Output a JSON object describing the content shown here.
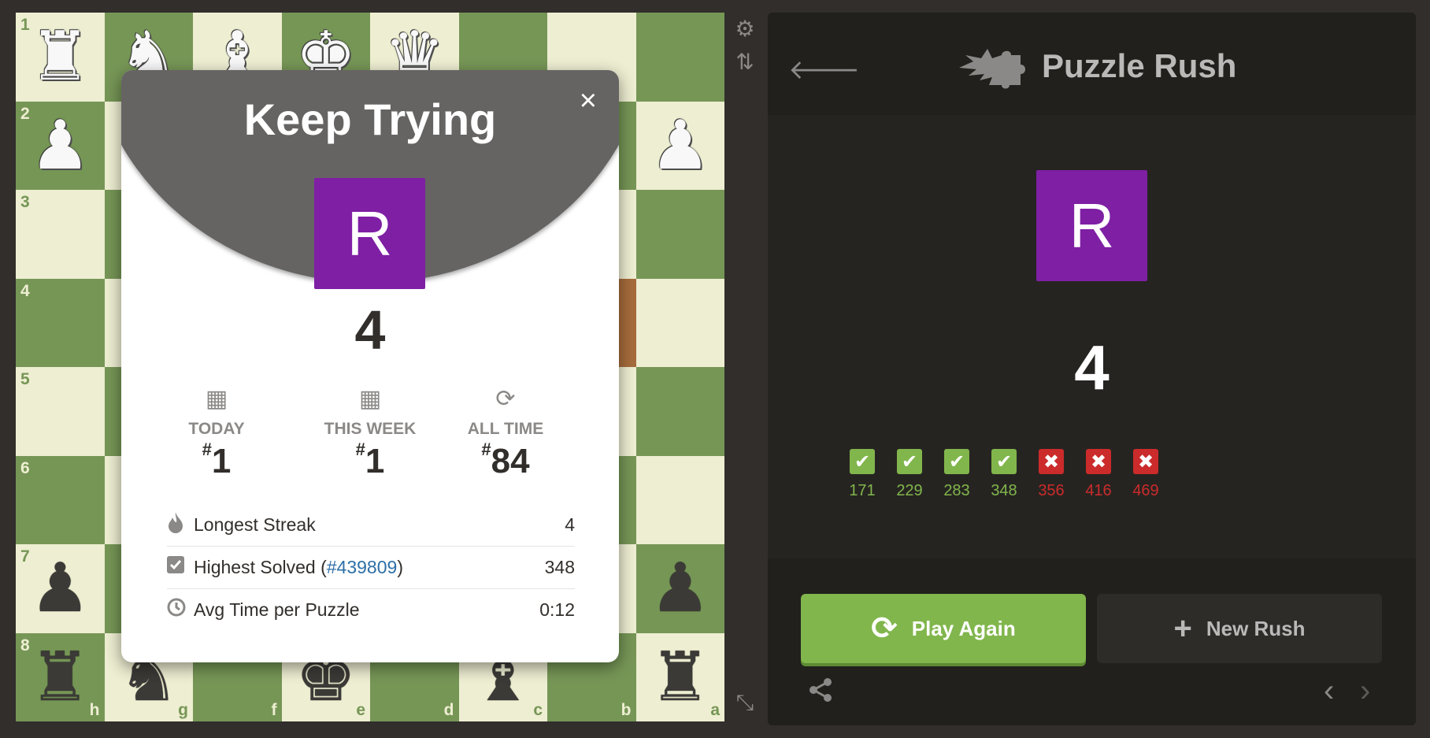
{
  "board": {
    "ranks": [
      "1",
      "2",
      "3",
      "4",
      "5",
      "6",
      "7",
      "8"
    ],
    "files": [
      "h",
      "g",
      "f",
      "e",
      "d",
      "c",
      "b",
      "a"
    ],
    "pieces": [
      {
        "square": "h1",
        "glyph": "♜",
        "color": "w",
        "name": "white-rook"
      },
      {
        "square": "g1",
        "glyph": "♞",
        "color": "w",
        "name": "white-knight"
      },
      {
        "square": "f1",
        "glyph": "♝",
        "color": "w",
        "name": "white-bishop"
      },
      {
        "square": "e1",
        "glyph": "♚",
        "color": "w",
        "name": "white-king"
      },
      {
        "square": "d1",
        "glyph": "♛",
        "color": "w",
        "name": "white-queen"
      },
      {
        "square": "h2",
        "glyph": "♟",
        "color": "w",
        "name": "white-pawn"
      },
      {
        "square": "a2",
        "glyph": "♟",
        "color": "w",
        "name": "white-pawn"
      },
      {
        "square": "h7",
        "glyph": "♟",
        "color": "b",
        "name": "black-pawn"
      },
      {
        "square": "a7",
        "glyph": "♟",
        "color": "b",
        "name": "black-pawn"
      },
      {
        "square": "h8",
        "glyph": "♜",
        "color": "b",
        "name": "black-rook"
      },
      {
        "square": "g8",
        "glyph": "♞",
        "color": "b",
        "name": "black-knight"
      },
      {
        "square": "e8",
        "glyph": "♚",
        "color": "b",
        "name": "black-king"
      },
      {
        "square": "c8",
        "glyph": "♝",
        "color": "b",
        "name": "black-bishop"
      },
      {
        "square": "a8",
        "glyph": "♜",
        "color": "b",
        "name": "black-rook"
      }
    ],
    "highlight_squares": [
      "b4"
    ],
    "colors": {
      "light": "#eeeed2",
      "dark": "#769656",
      "highlight": "#a66c3c"
    }
  },
  "tools": {
    "settings_icon": "gear-icon",
    "flip_icon": "flip-board-icon",
    "expand_icon": "expand-icon"
  },
  "modal": {
    "title": "Keep Trying",
    "close": "×",
    "avatar_letter": "R",
    "score": "4",
    "ranks": [
      {
        "icon": "calendar-icon",
        "glyph": "▦",
        "label": "TODAY",
        "value": "1"
      },
      {
        "icon": "calendar-icon",
        "glyph": "▦",
        "label": "THIS WEEK",
        "value": "1"
      },
      {
        "icon": "refresh-icon",
        "glyph": "⟳",
        "label": "ALL TIME",
        "value": "84"
      }
    ],
    "stats": [
      {
        "icon": "flame-icon",
        "glyph": "🔥",
        "label": "Longest Streak",
        "link": "",
        "value": "4"
      },
      {
        "icon": "checkbox-icon",
        "glyph": "☑",
        "label": "Highest Solved",
        "link": "#439809",
        "value": "348"
      },
      {
        "icon": "clock-icon",
        "glyph": "◷",
        "label": "Avg Time per Puzzle",
        "link": "",
        "value": "0:12"
      }
    ]
  },
  "panel": {
    "title": "Puzzle Rush",
    "avatar_letter": "R",
    "score": "4",
    "results": [
      {
        "status": "solved",
        "value": "171"
      },
      {
        "status": "solved",
        "value": "229"
      },
      {
        "status": "solved",
        "value": "283"
      },
      {
        "status": "solved",
        "value": "348"
      },
      {
        "status": "failed",
        "value": "356"
      },
      {
        "status": "failed",
        "value": "416"
      },
      {
        "status": "failed",
        "value": "469"
      }
    ],
    "play_again": "Play Again",
    "new_rush": "New Rush",
    "colors": {
      "avatar": "#7e1fa4",
      "success": "#81b64c",
      "fail": "#cb2b2b"
    }
  }
}
